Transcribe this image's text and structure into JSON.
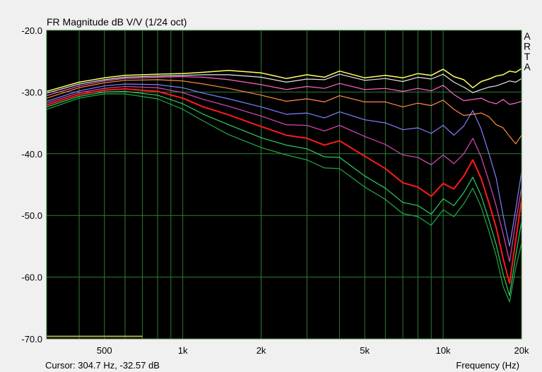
{
  "chart_data": {
    "type": "line",
    "title": "FR Magnitude dB V/V (1/24 oct)",
    "xlabel": "Frequency (Hz)",
    "ylabel": "",
    "xscale": "log",
    "xlim": [
      300,
      20000
    ],
    "ylim": [
      -70,
      -20
    ],
    "x_tick_values": [
      500,
      1000,
      2000,
      5000,
      10000,
      20000
    ],
    "x_tick_labels": [
      "500",
      "1k",
      "2k",
      "5k",
      "10k",
      "20k"
    ],
    "y_ticks": [
      -20,
      -30,
      -40,
      -50,
      -60,
      -70
    ],
    "y_tick_labels": [
      "-20.0",
      "-30.0",
      "-40.0",
      "-50.0",
      "-60.0",
      "-70.0"
    ],
    "grid": true,
    "background": "#000000",
    "grid_color": "#2e7d32",
    "watermark": [
      "A",
      "R",
      "T",
      "A"
    ],
    "cursor_text": "Cursor: 304.7 Hz, -32.57 dB",
    "cursor_marker": {
      "x_start": 300,
      "x_end": 700,
      "y": -69.6,
      "color": "#b5a642"
    },
    "series": [
      {
        "color": "#ffff66",
        "width": 1.5,
        "x": [
          300,
          400,
          500,
          600,
          800,
          1000,
          1200,
          1500,
          2000,
          2500,
          3000,
          3500,
          4000,
          5000,
          6000,
          7000,
          8000,
          9000,
          10000,
          11000,
          12000,
          13000,
          14000,
          15000,
          16000,
          17000,
          18000,
          19000,
          20000
        ],
        "values": [
          -29.9,
          -28.4,
          -27.7,
          -27.3,
          -27.1,
          -27.0,
          -26.8,
          -26.5,
          -26.9,
          -27.8,
          -27.2,
          -27.6,
          -26.6,
          -27.7,
          -27.3,
          -27.7,
          -27.0,
          -27.3,
          -26.3,
          -27.5,
          -28.0,
          -29.3,
          -28.3,
          -27.9,
          -27.4,
          -27.2,
          -26.6,
          -26.8,
          -26.2
        ]
      },
      {
        "color": "#e6e6e6",
        "width": 1.2,
        "x": [
          300,
          400,
          500,
          600,
          800,
          1000,
          1200,
          1500,
          2000,
          2500,
          3000,
          3500,
          4000,
          5000,
          6000,
          7000,
          8000,
          9000,
          10000,
          11000,
          12000,
          13000,
          14000,
          15000,
          16000,
          17000,
          18000,
          19000,
          20000
        ],
        "values": [
          -30.2,
          -28.7,
          -28.0,
          -27.6,
          -27.4,
          -27.3,
          -27.2,
          -27.2,
          -27.6,
          -28.4,
          -27.9,
          -28.0,
          -27.1,
          -28.1,
          -27.8,
          -28.3,
          -27.6,
          -27.9,
          -27.1,
          -28.4,
          -29.2,
          -30.1,
          -29.6,
          -29.2,
          -29.0,
          -28.6,
          -28.2,
          -28.4,
          -27.8
        ]
      },
      {
        "color": "#ff66cc",
        "width": 1.2,
        "x": [
          300,
          400,
          500,
          600,
          800,
          1000,
          1200,
          1500,
          2000,
          2500,
          3000,
          3500,
          4000,
          5000,
          6000,
          7000,
          8000,
          9000,
          10000,
          11000,
          12000,
          13000,
          14000,
          15000,
          16000,
          17000,
          18000,
          19000,
          20000
        ],
        "values": [
          -30.6,
          -29.0,
          -28.2,
          -27.8,
          -27.6,
          -27.5,
          -27.6,
          -28.0,
          -28.8,
          -29.6,
          -29.1,
          -29.4,
          -28.6,
          -29.6,
          -29.4,
          -29.9,
          -29.4,
          -29.8,
          -28.9,
          -30.4,
          -31.4,
          -31.2,
          -31.0,
          -31.6,
          -31.9,
          -31.2,
          -32.0,
          -31.8,
          -31.5
        ]
      },
      {
        "color": "#ff8c42",
        "width": 1.2,
        "x": [
          300,
          400,
          500,
          600,
          800,
          1000,
          1200,
          1500,
          2000,
          2500,
          3000,
          3500,
          4000,
          5000,
          6000,
          7000,
          8000,
          9000,
          10000,
          11000,
          12000,
          13000,
          14000,
          15000,
          16000,
          17000,
          18000,
          19000,
          20000
        ],
        "values": [
          -31.0,
          -29.3,
          -28.5,
          -28.1,
          -28.0,
          -28.2,
          -28.7,
          -29.4,
          -30.5,
          -31.5,
          -31.1,
          -31.6,
          -30.6,
          -31.6,
          -31.6,
          -32.4,
          -31.8,
          -32.2,
          -31.3,
          -32.8,
          -33.8,
          -33.6,
          -33.4,
          -34.0,
          -35.3,
          -35.8,
          -37.2,
          -38.4,
          -37.0
        ]
      },
      {
        "color": "#8080ff",
        "width": 1.2,
        "x": [
          300,
          400,
          500,
          600,
          800,
          1000,
          1200,
          1500,
          2000,
          2500,
          3000,
          3500,
          4000,
          5000,
          6000,
          7000,
          8000,
          9000,
          10000,
          11000,
          12000,
          13000,
          14000,
          15000,
          16000,
          17000,
          18000,
          19000,
          20000
        ],
        "values": [
          -31.5,
          -29.8,
          -29.0,
          -28.7,
          -28.8,
          -29.3,
          -30.2,
          -31.1,
          -32.4,
          -33.6,
          -33.4,
          -34.2,
          -33.2,
          -34.5,
          -35.0,
          -36.1,
          -35.8,
          -36.7,
          -35.4,
          -37.0,
          -35.5,
          -33.0,
          -36.0,
          -40.0,
          -44.0,
          -50.0,
          -55.0,
          -49.0,
          -43.0
        ]
      },
      {
        "color": "#cc44aa",
        "width": 1.3,
        "x": [
          300,
          400,
          500,
          600,
          800,
          1000,
          1200,
          1500,
          2000,
          2500,
          3000,
          3500,
          4000,
          5000,
          6000,
          7000,
          8000,
          9000,
          10000,
          11000,
          12000,
          13000,
          14000,
          15000,
          16000,
          17000,
          18000,
          19000,
          20000
        ],
        "values": [
          -31.8,
          -30.1,
          -29.4,
          -29.1,
          -29.3,
          -30.1,
          -31.2,
          -32.3,
          -33.9,
          -35.3,
          -35.4,
          -36.3,
          -35.4,
          -37.2,
          -38.5,
          -40.2,
          -40.6,
          -41.8,
          -40.2,
          -41.6,
          -40.0,
          -37.5,
          -40.5,
          -44.5,
          -48.5,
          -53.0,
          -57.5,
          -51.0,
          -45.5
        ]
      },
      {
        "color": "#ff1a1a",
        "width": 2.0,
        "x": [
          300,
          400,
          500,
          600,
          800,
          1000,
          1200,
          1500,
          2000,
          2500,
          3000,
          3500,
          4000,
          5000,
          6000,
          7000,
          8000,
          9000,
          10000,
          11000,
          12000,
          13000,
          14000,
          15000,
          16000,
          17000,
          18000,
          19000,
          20000
        ],
        "values": [
          -32.1,
          -30.4,
          -29.7,
          -29.5,
          -29.9,
          -31.0,
          -32.4,
          -33.7,
          -35.6,
          -37.0,
          -37.5,
          -38.6,
          -37.9,
          -40.4,
          -42.4,
          -44.7,
          -45.4,
          -46.9,
          -44.8,
          -45.7,
          -43.6,
          -41.0,
          -44.0,
          -48.0,
          -52.0,
          -57.0,
          -61.0,
          -54.0,
          -47.5
        ]
      },
      {
        "color": "#33cc66",
        "width": 1.2,
        "x": [
          300,
          400,
          500,
          600,
          800,
          1000,
          1200,
          1500,
          2000,
          2500,
          3000,
          3500,
          4000,
          5000,
          6000,
          7000,
          8000,
          9000,
          10000,
          11000,
          12000,
          13000,
          14000,
          15000,
          16000,
          17000,
          18000,
          19000,
          20000
        ],
        "values": [
          -32.4,
          -30.7,
          -30.0,
          -29.9,
          -30.5,
          -31.9,
          -33.6,
          -35.3,
          -37.4,
          -38.6,
          -39.2,
          -40.5,
          -40.6,
          -43.6,
          -45.6,
          -47.9,
          -48.4,
          -49.8,
          -47.3,
          -48.4,
          -46.3,
          -43.8,
          -46.8,
          -50.8,
          -54.8,
          -59.5,
          -63.0,
          -56.5,
          -51.0
        ]
      },
      {
        "color": "#22aa44",
        "width": 1.2,
        "x": [
          300,
          400,
          500,
          600,
          800,
          1000,
          1200,
          1500,
          2000,
          2500,
          3000,
          3500,
          4000,
          5000,
          6000,
          7000,
          8000,
          9000,
          10000,
          11000,
          12000,
          13000,
          14000,
          15000,
          16000,
          17000,
          18000,
          19000,
          20000
        ],
        "values": [
          -32.8,
          -31.0,
          -30.3,
          -30.3,
          -31.1,
          -32.8,
          -34.7,
          -36.9,
          -39.0,
          -40.2,
          -41.0,
          -42.3,
          -42.4,
          -45.4,
          -47.4,
          -49.7,
          -50.2,
          -51.6,
          -49.1,
          -50.2,
          -48.1,
          -45.6,
          -48.6,
          -52.6,
          -56.6,
          -61.5,
          -64.0,
          -58.5,
          -54.5
        ]
      }
    ]
  }
}
